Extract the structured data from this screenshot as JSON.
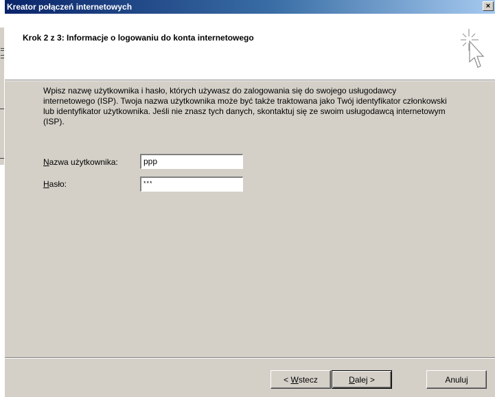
{
  "dialog": {
    "title": "Kreator połączeń internetowych",
    "close_glyph": "×"
  },
  "header": {
    "title": "Krok 2 z 3: Informacje o logowaniu do konta internetowego",
    "icon": "wizard-cursor-sparkle-icon"
  },
  "body": {
    "description": "Wpisz nazwę użytkownika i hasło, których używasz do zalogowania się do swojego usługodawcy internetowego (ISP). Twoja nazwa użytkownika może być także traktowana jako Twój identyfikator członkowski lub identyfikator użytkownika. Jeśli nie znasz tych danych, skontaktuj się ze swoim usługodawcą internetowym (ISP).",
    "username_label_hotkey": "N",
    "username_label_rest": "azwa użytkownika:",
    "username_value": "ppp",
    "password_label_hotkey": "H",
    "password_label_rest": "asło:",
    "password_value": "***"
  },
  "buttons": {
    "back_prefix": "< ",
    "back_hotkey": "W",
    "back_rest": "stecz",
    "next_hotkey": "D",
    "next_rest": "alej >",
    "cancel": "Anuluj"
  },
  "colors": {
    "title_gradient_start": "#0a246a",
    "title_gradient_end": "#a6caf0",
    "dialog_face": "#d4d0c8"
  }
}
